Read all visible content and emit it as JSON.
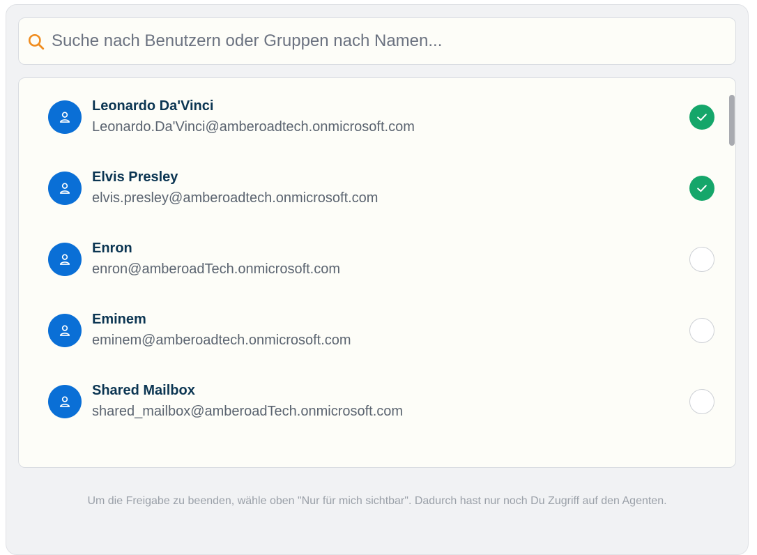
{
  "search": {
    "placeholder": "Suche nach Benutzern oder Gruppen nach Namen...",
    "value": "",
    "icon": "search-icon",
    "icon_color": "#f08c1e"
  },
  "users": [
    {
      "name": "Leonardo Da'Vinci",
      "email": "Leonardo.Da'Vinci@amberoadtech.onmicrosoft.com",
      "selected": true
    },
    {
      "name": "Elvis Presley",
      "email": "elvis.presley@amberoadtech.onmicrosoft.com",
      "selected": true
    },
    {
      "name": "Enron",
      "email": "enron@amberoadTech.onmicrosoft.com",
      "selected": false
    },
    {
      "name": "Eminem",
      "email": "eminem@amberoadtech.onmicrosoft.com",
      "selected": false
    },
    {
      "name": "Shared Mailbox",
      "email": "shared_mailbox@amberoadTech.onmicrosoft.com",
      "selected": false
    }
  ],
  "footer": {
    "note": "Um die Freigabe zu beenden, wähle oben \"Nur für mich sichtbar\". Dadurch hast nur noch Du Zugriff auf den Agenten."
  },
  "colors": {
    "avatar": "#0a6fd6",
    "selected": "#15a66a",
    "name_text": "#0b3552"
  }
}
